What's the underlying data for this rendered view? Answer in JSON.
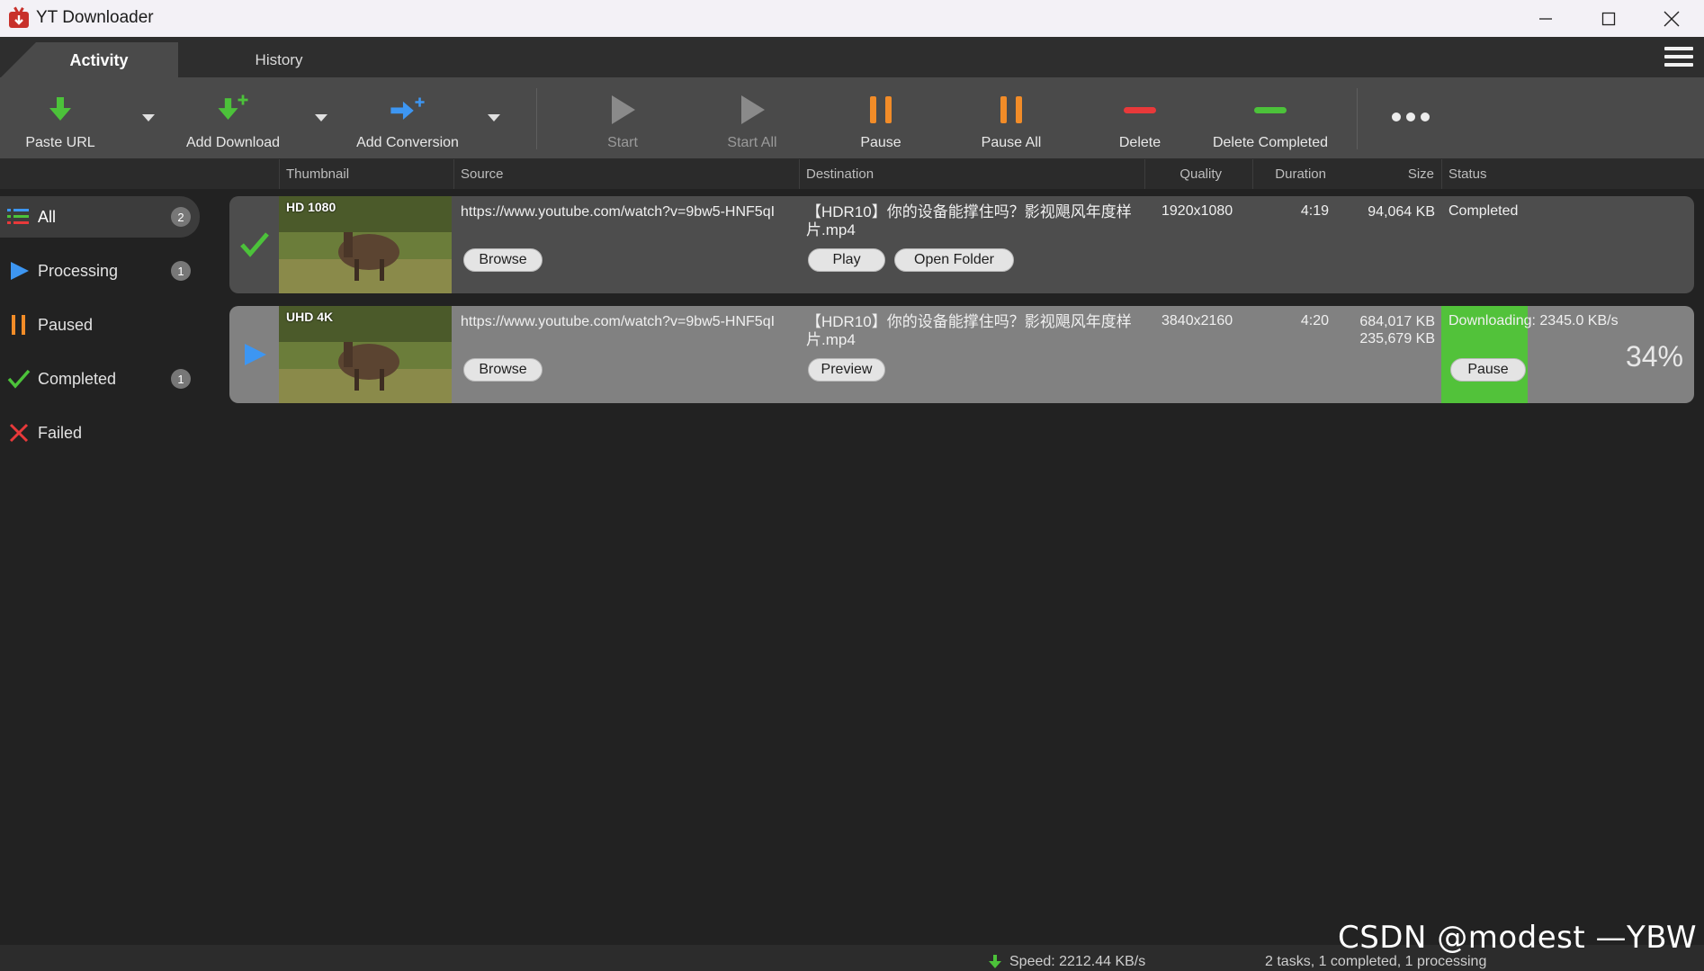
{
  "window": {
    "title": "YT Downloader"
  },
  "tabs": [
    {
      "label": "Activity"
    },
    {
      "label": "History"
    }
  ],
  "toolbar": {
    "paste_url": "Paste URL",
    "add_download": "Add Download",
    "add_conversion": "Add Conversion",
    "start": "Start",
    "start_all": "Start All",
    "pause": "Pause",
    "pause_all": "Pause All",
    "delete": "Delete",
    "delete_completed": "Delete Completed"
  },
  "columns": {
    "thumbnail": "Thumbnail",
    "source": "Source",
    "destination": "Destination",
    "quality": "Quality",
    "duration": "Duration",
    "size": "Size",
    "status": "Status"
  },
  "sidebar": {
    "items": [
      {
        "label": "All",
        "count": "2"
      },
      {
        "label": "Processing",
        "count": "1"
      },
      {
        "label": "Paused",
        "count": ""
      },
      {
        "label": "Completed",
        "count": "1"
      },
      {
        "label": "Failed",
        "count": ""
      }
    ]
  },
  "rows": [
    {
      "thumb_badge": "HD 1080",
      "source": "https://www.youtube.com/watch?v=9bw5-HNF5qI",
      "browse": "Browse",
      "destination": "【HDR10】你的设备能撑住吗？影视飓风年度样片.mp4",
      "action1": "Play",
      "action2": "Open Folder",
      "quality": "1920x1080",
      "duration": "4:19",
      "size": "94,064 KB",
      "size2": "",
      "status": "Completed"
    },
    {
      "thumb_badge": "UHD 4K",
      "source": "https://www.youtube.com/watch?v=9bw5-HNF5qI",
      "browse": "Browse",
      "destination": "【HDR10】你的设备能撑住吗？影视飓风年度样片.mp4",
      "action1": "Preview",
      "quality": "3840x2160",
      "duration": "4:20",
      "size": "684,017 KB",
      "size2": "235,679 KB",
      "status": "Downloading: 2345.0 KB/s",
      "progress_label": "34%",
      "progress": 0.34,
      "pause_button": "Pause"
    }
  ],
  "statusbar": {
    "speed": "Speed: 2212.44 KB/s",
    "summary": "2 tasks, 1 completed, 1 processing"
  },
  "watermark": "CSDN @modest —YBW",
  "colors": {
    "accent_green": "#52c23a",
    "pause_orange": "#f28c28",
    "delete_red": "#e8393a",
    "processing_blue": "#3d96f2"
  }
}
